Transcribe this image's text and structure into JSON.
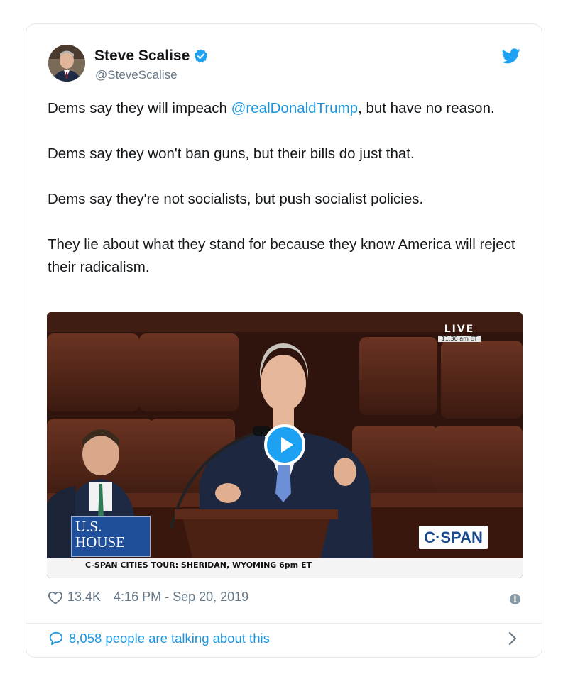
{
  "tweet": {
    "author_name": "Steve Scalise",
    "handle": "@SteveScalise",
    "paragraphs": [
      {
        "before": "Dems say they will impeach ",
        "mention": "@realDonaldTrump",
        "after": ", but have no reason."
      },
      {
        "text": "Dems say they won't ban guns, but their bills do just that."
      },
      {
        "text": "Dems say they're not socialists, but push socialist policies."
      },
      {
        "text": "They lie about what they stand for because they know America will reject their radicalism."
      }
    ],
    "likes": "13.4K",
    "timestamp": "4:16 PM - Sep 20, 2019",
    "talking": "8,058 people are talking about this"
  },
  "video": {
    "live_label": "LIVE",
    "live_time": "11:30 am ET",
    "house_logo_line1": "U.S.",
    "house_logo_line2": "HOUSE",
    "network_logo": "C·SPAN",
    "ticker": "C-SPAN CITIES TOUR: SHERIDAN, WYOMING 6pm ET"
  },
  "icons": {
    "verified": "verified-badge-icon",
    "bird": "twitter-bird-icon",
    "play": "play-icon",
    "heart": "heart-icon",
    "info": "info-icon",
    "bubble": "speech-bubble-icon",
    "chevron": "chevron-right-icon"
  },
  "colors": {
    "accent": "#1da1f2",
    "link": "#1b95e0",
    "muted": "#657786",
    "text": "#14171a"
  }
}
